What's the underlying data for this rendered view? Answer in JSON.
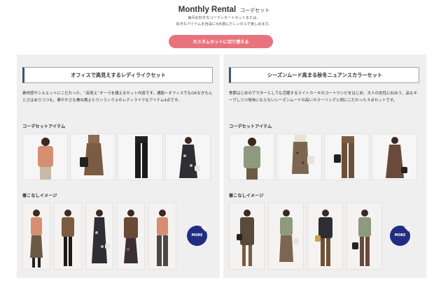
{
  "header": {
    "title": "Monthly Rental",
    "subtitle": "コーデセット",
    "lead_line1": "毎月お好きなコーディネートセットまたは、",
    "lead_line2": "好きなアイテムを自由に4点選んでレンタルで楽しめます。",
    "switch_button": "カスタムセットに切り替える"
  },
  "sets": [
    {
      "title": "オフィスで高見えするレディライクセット",
      "description": "素材感やシルエットにこだわった、“高見え”オーラを纏えるセット内容です。通勤〜オフィスでもOKなきちんとさはありつつも、華やかさも兼ね備えたワンランク上のレディライクなアイテム4点です。",
      "items_label": "コーデセットアイテム",
      "looks_label": "着こなしイメージ",
      "more_label": "MORE"
    },
    {
      "title": "シーズンムード高まる秋冬ニュアンスカラーセット",
      "description": "季節はじめのアウターとしても活躍するライトカーキのコートワンピをはじめ、大人の女性に似合う、品もキープしつつ地味にならないシーズンムードの高いカラーリングと柄にこだわった４点セットです。",
      "items_label": "コーデセットアイテム",
      "looks_label": "着こなしイメージ",
      "more_label": "MORE"
    }
  ],
  "colors": {
    "accent_button": "#e9737d",
    "more_button": "#1f2e82",
    "title_border": "#3e5576",
    "panel_bg": "#efefef"
  }
}
